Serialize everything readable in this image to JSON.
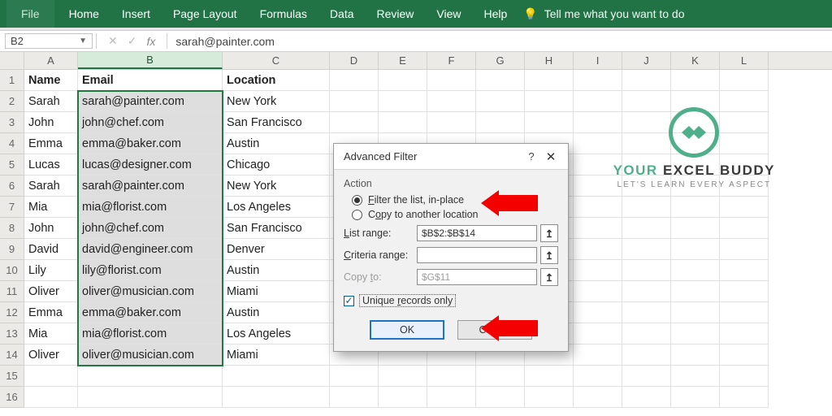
{
  "ribbon": {
    "tabs": [
      "File",
      "Home",
      "Insert",
      "Page Layout",
      "Formulas",
      "Data",
      "Review",
      "View",
      "Help"
    ],
    "tell_me": "Tell me what you want to do"
  },
  "namebox": "B2",
  "formula": "sarah@painter.com",
  "columns": [
    "A",
    "B",
    "C",
    "D",
    "E",
    "F",
    "G",
    "H",
    "I",
    "J",
    "K",
    "L"
  ],
  "headers": {
    "A": "Name",
    "B": "Email",
    "C": "Location"
  },
  "rows": [
    {
      "n": "1"
    },
    {
      "n": "2",
      "A": "Sarah",
      "B": "sarah@painter.com",
      "C": "New York"
    },
    {
      "n": "3",
      "A": "John",
      "B": "john@chef.com",
      "C": "San Francisco"
    },
    {
      "n": "4",
      "A": "Emma",
      "B": "emma@baker.com",
      "C": "Austin"
    },
    {
      "n": "5",
      "A": "Lucas",
      "B": "lucas@designer.com",
      "C": "Chicago"
    },
    {
      "n": "6",
      "A": "Sarah",
      "B": "sarah@painter.com",
      "C": "New York"
    },
    {
      "n": "7",
      "A": "Mia",
      "B": "mia@florist.com",
      "C": "Los Angeles"
    },
    {
      "n": "8",
      "A": "John",
      "B": "john@chef.com",
      "C": "San Francisco"
    },
    {
      "n": "9",
      "A": "David",
      "B": "david@engineer.com",
      "C": "Denver"
    },
    {
      "n": "10",
      "A": "Lily",
      "B": "lily@florist.com",
      "C": "Austin"
    },
    {
      "n": "11",
      "A": "Oliver",
      "B": "oliver@musician.com",
      "C": "Miami"
    },
    {
      "n": "12",
      "A": "Emma",
      "B": "emma@baker.com",
      "C": "Austin"
    },
    {
      "n": "13",
      "A": "Mia",
      "B": "mia@florist.com",
      "C": "Los Angeles"
    },
    {
      "n": "14",
      "A": "Oliver",
      "B": "oliver@musician.com",
      "C": "Miami"
    },
    {
      "n": "15"
    },
    {
      "n": "16"
    }
  ],
  "dialog": {
    "title": "Advanced Filter",
    "action_label": "Action",
    "radio1": "Filter the list, in-place",
    "radio2": "Copy to another location",
    "list_label": "List range:",
    "list_value": "$B$2:$B$14",
    "criteria_label": "Criteria range:",
    "criteria_value": "",
    "copyto_label": "Copy to:",
    "copyto_value": "$G$11",
    "unique_label": "Unique records only",
    "ok": "OK",
    "cancel": "Cancel"
  },
  "brand": {
    "word1": "YOUR",
    "word2": "EXCEL",
    "word3": "BUDDY",
    "sub": "LET'S LEARN EVERY ASPECT"
  }
}
